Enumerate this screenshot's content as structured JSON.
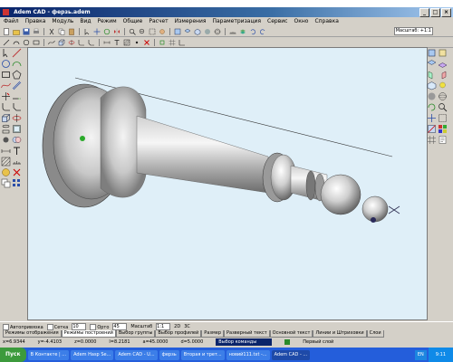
{
  "window": {
    "title": "Adem CAD - ферзь.adem",
    "controls": [
      "_",
      "□",
      "×"
    ]
  },
  "menu": [
    "Файл",
    "Правка",
    "Модуль",
    "Вид",
    "Режим",
    "Общие",
    "Расчет",
    "Измерения",
    "Параметризация",
    "Сервис",
    "Окно",
    "Справка"
  ],
  "toolbar": {
    "scale_field": "Масштаб: +1:1"
  },
  "viewport": {
    "background": "#dfeff8",
    "model": "queen-chess-piece"
  },
  "status": {
    "autoprivyazka": "Автопривязка",
    "grid_label": "Сетка",
    "grid_value": "10",
    "ortho_label": "Орто",
    "ortho_value": "45",
    "scale_label": "Масштаб",
    "scale_value": "1:1",
    "mode_2d": "2D",
    "mode_3c": "3С"
  },
  "tabs": [
    "Режимы отображения",
    "Режимы построений",
    "Выбор группы",
    "Выбор профилей",
    "Размер",
    "Разверный текст",
    "Основной текст",
    "Линии и Штриховки",
    "Слои"
  ],
  "coords": {
    "x": "x=6.9344",
    "y": "y=-4.4103",
    "z": "z=0.0000",
    "l": "l=8.2181",
    "a": "a=45.0000",
    "d": "d=5.0000",
    "command": "Выбор команды",
    "layer": "Первый слой"
  },
  "taskbar": {
    "start": "Пуск",
    "tasks": [
      "В Контакте | ...",
      "Adem Hasp Se...",
      "Adem CAD - U...",
      "ферзь",
      "Вторая и трет...",
      "новий111.txt -...",
      "Adem CAD - ..."
    ],
    "lang": "EN",
    "time": "9:11"
  },
  "colors": {
    "titlebar": "#0a246a",
    "viewport": "#dfeff8",
    "taskbar": "#245edb",
    "start": "#3c9a3c"
  }
}
